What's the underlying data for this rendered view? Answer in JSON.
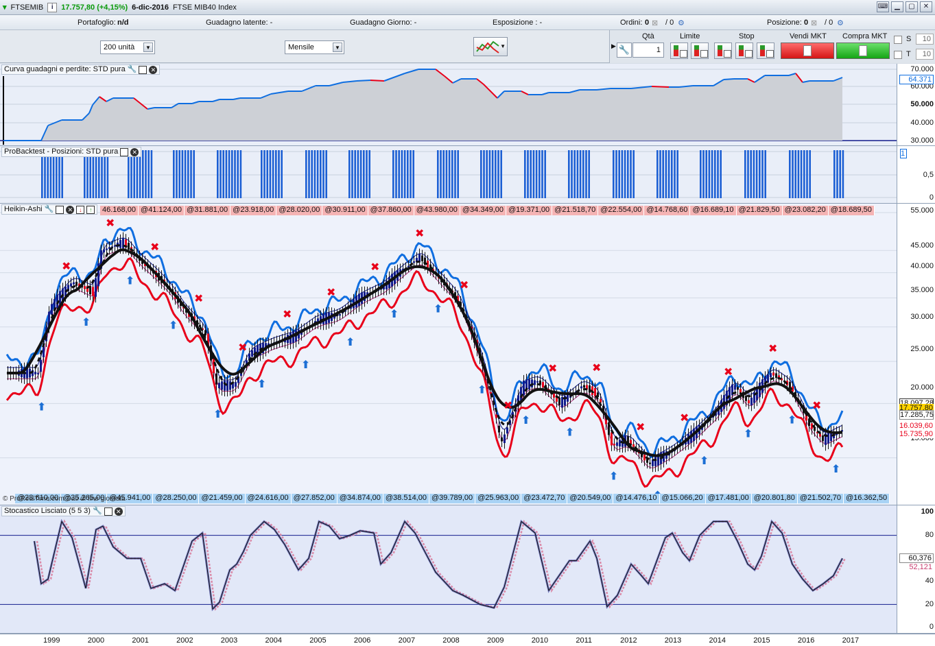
{
  "titlebar": {
    "symbol": "FTSEMIB",
    "info_icon": "i",
    "price": "17.757,80 (+4,15%)",
    "date": "6-dic-2016",
    "name": "FTSE MIB40 Index"
  },
  "portfolio": {
    "portafoglio_label": "Portafoglio:",
    "portafoglio_value": "n/d",
    "guadagno_latente": "Guadagno latente:  -",
    "guadagno_giorno": "Guadagno Giorno:  -",
    "esposizione": "Esposizione :  -",
    "ordini": "Ordini:",
    "ordini_value": "0",
    "ordini_slash": "/ 0",
    "posizione": "Posizione:",
    "posizione_value": "0",
    "posizione_slash": "/ 0"
  },
  "controls": {
    "units": "200 unità",
    "period": "Mensile"
  },
  "orders": {
    "qta_label": "Qtà",
    "qta_value": "1",
    "limite_label": "Limite",
    "stop_label": "Stop",
    "vendi_label": "Vendi MKT",
    "compra_label": "Compra MKT",
    "s_label": "S",
    "t_label": "T",
    "s_value": "10",
    "t_value": "10"
  },
  "colors": {
    "red": "#e8001a",
    "blue": "#0f6ee0",
    "navy": "#121c8c",
    "pink": "#c83c6e"
  },
  "panels": {
    "equity": {
      "title": "Curva guadagni e perdite: STD pura",
      "y_labels": [
        "70.000",
        "60.000",
        "50.000",
        "40.000",
        "30.000"
      ],
      "current": "64.371"
    },
    "positions": {
      "title": "ProBacktest - Posizioni: STD pura",
      "y_labels": [
        "1",
        "0,5",
        "0"
      ],
      "current": "1"
    },
    "price": {
      "title": "Heikin-Ashi",
      "y_labels": [
        "55.000",
        "45.000",
        "40.000",
        "35.000",
        "30.000",
        "25.000",
        "20.000",
        "15.000"
      ],
      "top_strip": [
        "46.168,00",
        "@41.124,00",
        "@31.881,00",
        "@23.918,00",
        "@28.020,00",
        "@30.911,00",
        "@37.860,00",
        "@43.980,00",
        "@34.349,00",
        "@19.371,00",
        "@21.518,70",
        "@22.554,00",
        "@14.768,60",
        "@16.689,10",
        "@21.829,50",
        "@23.082,20",
        "@18.689,50"
      ],
      "bottom_strip": [
        "@28.610,00",
        "@35.265,00",
        "@45.941,00",
        "@28.250,00",
        "@21.459,00",
        "@24.616,00",
        "@27.852,00",
        "@34.874,00",
        "@38.514,00",
        "@39.789,00",
        "@25.963,00",
        "@23.472,70",
        "@20.549,00",
        "@14.476,10",
        "@15.066,20",
        "@17.481,00",
        "@20.801,80",
        "@21.502,70",
        "@16.362,50"
      ],
      "markers": [
        "18.097,28",
        "17.757,80",
        "17.285,75",
        "16.039,60",
        "15.735,90"
      ],
      "copyright": "© ProRealTime.com Dati di fine giornata"
    },
    "stoch": {
      "title": "Stocastico Lisciato (5 5 3)",
      "y_labels": [
        "100",
        "80",
        "60",
        "40",
        "20",
        "0"
      ],
      "current1": "60,376",
      "current2": "52,121"
    }
  },
  "xaxis": {
    "years": [
      "1999",
      "2000",
      "2001",
      "2002",
      "2003",
      "2004",
      "2005",
      "2006",
      "2007",
      "2008",
      "2009",
      "2010",
      "2011",
      "2012",
      "2013",
      "2014",
      "2015",
      "2016",
      "2017"
    ]
  },
  "chart_data": {
    "type": "line",
    "x": [
      "1998-10",
      "1999-01",
      "1999-07",
      "2000-01",
      "2000-03",
      "2000-09",
      "2001-01",
      "2001-09",
      "2002-01",
      "2002-07",
      "2002-10",
      "2003-03",
      "2003-07",
      "2004-01",
      "2004-07",
      "2005-01",
      "2005-07",
      "2006-01",
      "2006-07",
      "2007-01",
      "2007-05",
      "2007-10",
      "2008-03",
      "2008-09",
      "2009-03",
      "2009-09",
      "2010-01",
      "2010-07",
      "2011-01",
      "2011-05",
      "2011-09",
      "2012-01",
      "2012-07",
      "2013-01",
      "2013-07",
      "2014-01",
      "2014-06",
      "2014-10",
      "2015-04",
      "2015-09",
      "2016-02",
      "2016-06",
      "2016-12"
    ],
    "series": [
      {
        "values": [
          23500,
          33000,
          38000,
          36000,
          45000,
          47000,
          43000,
          37000,
          33000,
          29000,
          22000,
          22000,
          26000,
          27500,
          28500,
          31000,
          32000,
          35000,
          37000,
          41000,
          43500,
          39000,
          35000,
          26000,
          16000,
          22000,
          22500,
          20000,
          22000,
          21000,
          16000,
          16500,
          14500,
          15500,
          17000,
          19000,
          22000,
          20000,
          23500,
          22000,
          18000,
          16500,
          17500
        ]
      }
    ],
    "ylim": [
      12000,
      56000
    ],
    "yscale": "log"
  }
}
